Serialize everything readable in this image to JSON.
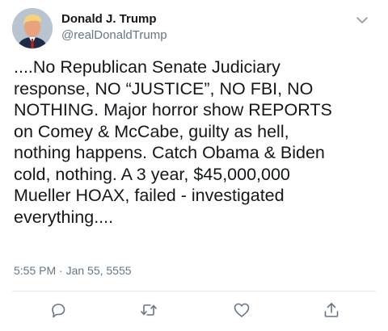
{
  "author": {
    "display_name": "Donald J. Trump",
    "handle": "@realDonaldTrump",
    "avatar_icon": "profile-photo"
  },
  "menu_icon": "chevron-down-icon",
  "tweet": {
    "text": "....No Republican Senate Judiciary\nresponse, NO “JUSTICE”, NO FBI, NO\nNOTHING. Major horror show REPORTS\non Comey & McCabe, guilty as hell,\nnothing happens. Catch Obama & Biden\ncold, nothing. A 3 year, $45,000,000\nMueller HOAX, failed - investigated\neverything....",
    "timestamp": "5:55 PM · Jan 55, 5555"
  },
  "actions": [
    {
      "icon": "reply-icon"
    },
    {
      "icon": "retweet-icon"
    },
    {
      "icon": "like-icon"
    },
    {
      "icon": "share-icon"
    }
  ],
  "colors": {
    "text": "#14171a",
    "secondary": "#657786",
    "divider": "#e1e8ed"
  }
}
